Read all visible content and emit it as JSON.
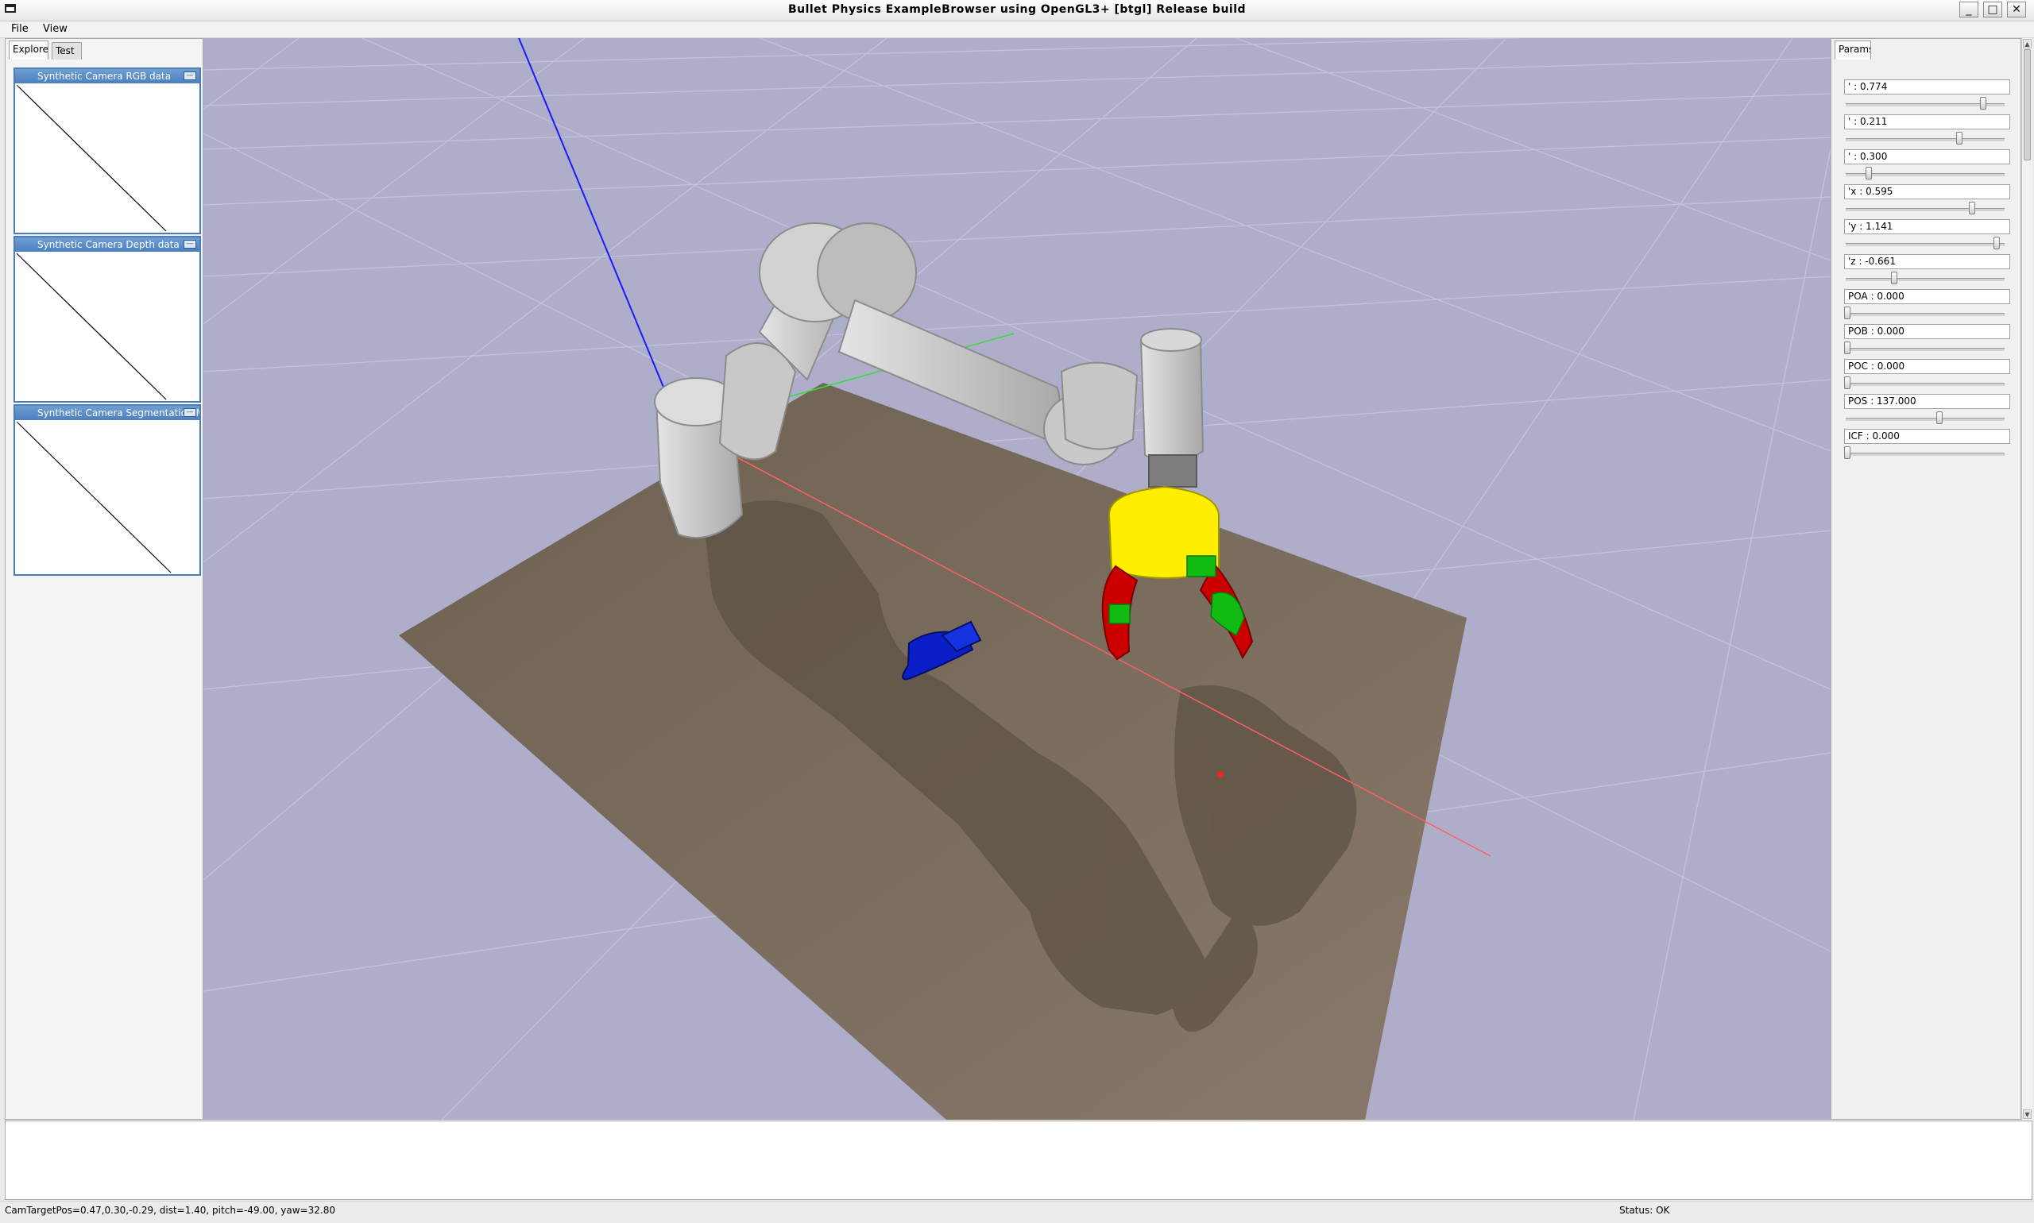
{
  "window": {
    "title": "Bullet Physics ExampleBrowser using OpenGL3+ [btgl] Release build",
    "minimize_label": "_",
    "maximize_label": "□",
    "close_label": "✕"
  },
  "menu": {
    "file": "File",
    "view": "View"
  },
  "explorer": {
    "tabs": [
      "Explorer",
      "Test"
    ],
    "camera_windows": [
      {
        "title": "Synthetic Camera RGB data"
      },
      {
        "title": "Synthetic Camera Depth data"
      },
      {
        "title": "Synthetic Camera Segmentation Mask"
      }
    ],
    "minimize_glyph": "—"
  },
  "params": {
    "tab": "Params",
    "items": [
      {
        "label": "' : 0.774",
        "level": 0.87
      },
      {
        "label": "' : 0.211",
        "level": 0.72
      },
      {
        "label": "' : 0.300",
        "level": 0.14
      },
      {
        "label": "'x : 0.595",
        "level": 0.8
      },
      {
        "label": "'y : 1.141",
        "level": 0.96
      },
      {
        "label": "'z : -0.661",
        "level": 0.3
      },
      {
        "label": "POA : 0.000",
        "level": 0.0
      },
      {
        "label": "POB : 0.000",
        "level": 0.0
      },
      {
        "label": "POC : 0.000",
        "level": 0.0
      },
      {
        "label": "POS : 137.000",
        "level": 0.59
      },
      {
        "label": "ICF : 0.000",
        "level": 0.0
      }
    ]
  },
  "status": {
    "camera": "CamTargetPos=0.47,0.30,-0.29, dist=1.40, pitch=-49.00, yaw=32.80",
    "state": "Status: OK"
  },
  "colors": {
    "sky": "#aeaecb",
    "table": "#7e6f5d",
    "robot": "#cfcfcf",
    "gripper_body": "#ffee00",
    "gripper_fingers": "#cc0000",
    "gripper_pads": "#11bb11",
    "object": "#0a1fc8"
  }
}
